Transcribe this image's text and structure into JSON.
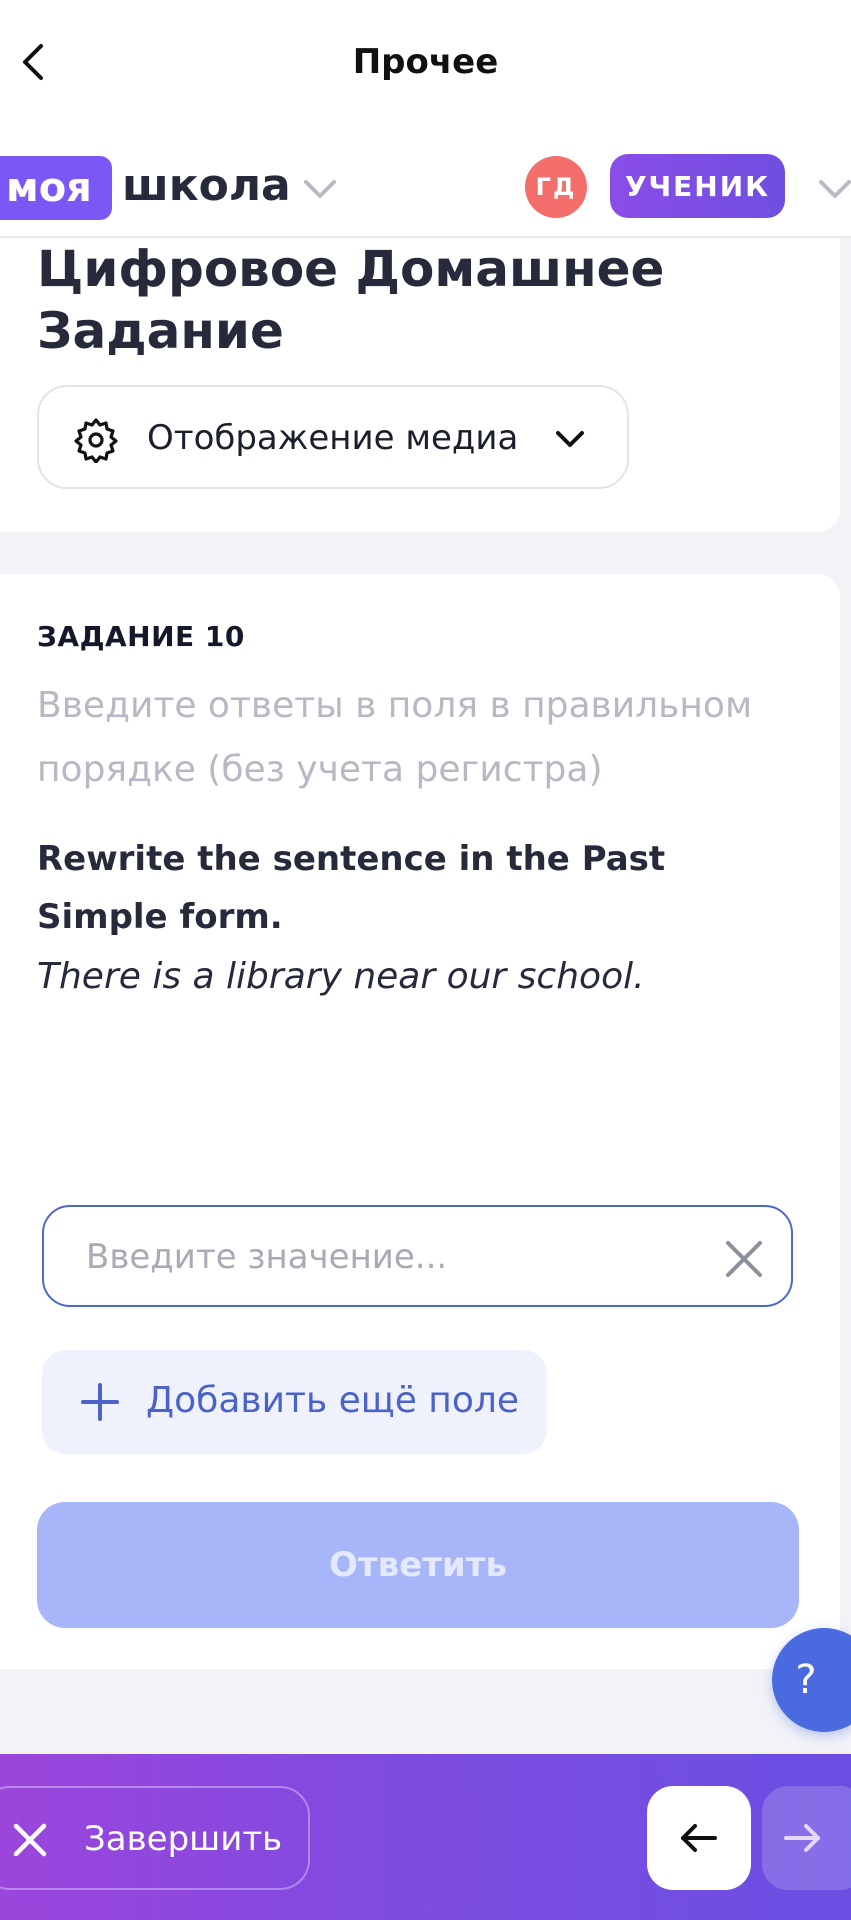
{
  "nav": {
    "title": "Прочее"
  },
  "header": {
    "logo_badge": "моя",
    "logo_text": "школа",
    "avatar_initials": "ГД",
    "role": "УЧЕНИК"
  },
  "page": {
    "title": "Цифровое Домашнее Задание",
    "media_button_label": "Отображение медиа"
  },
  "task": {
    "heading": "ЗАДАНИЕ 10",
    "hint": "Введите ответы в поля в правильном порядке (без учета регистра)",
    "question": "Rewrite the sentence in the Past Simple form.",
    "sentence": "There is a library near our school.",
    "input_placeholder": "Введите значение...",
    "input_value": "",
    "add_field_label": "Добавить ещё поле",
    "submit_label": "Ответить"
  },
  "help": {
    "label": "?"
  },
  "bottom": {
    "finish_label": "Завершить"
  },
  "colors": {
    "accent": "#7b57f5",
    "avatar": "#f46e6c",
    "primary_blue": "#4a6be0",
    "submit_disabled": "#a6b6f8"
  },
  "icons": {
    "back": "chevron-left-icon",
    "gear": "gear-icon",
    "close": "close-icon",
    "plus": "plus-icon",
    "prev": "arrow-left-icon",
    "next": "arrow-right-icon"
  }
}
